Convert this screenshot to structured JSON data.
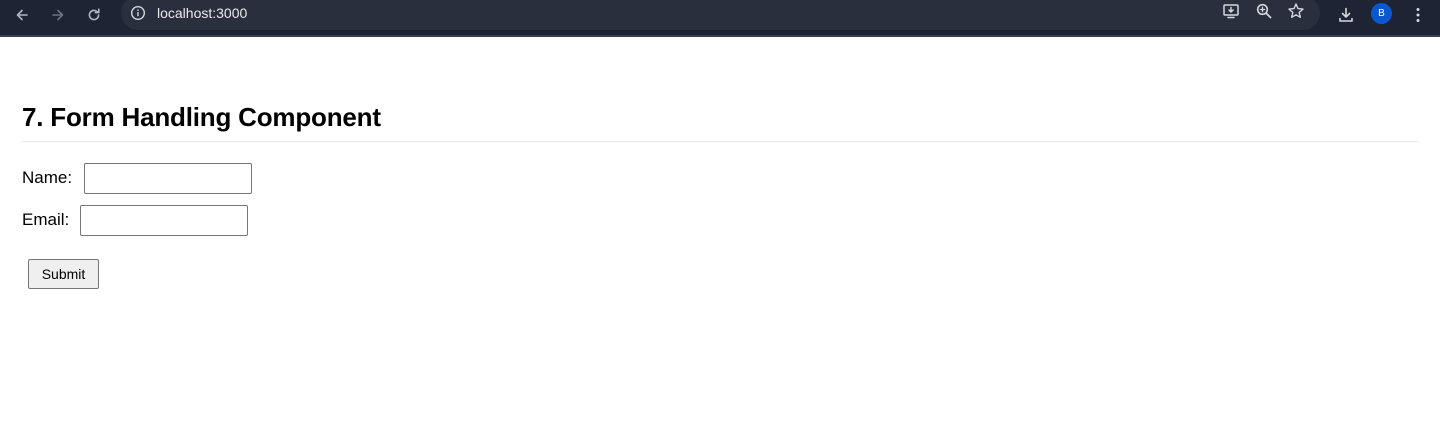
{
  "browser": {
    "url": "localhost:3000",
    "profile_initial": "B",
    "colors": {
      "toolbar_bg": "#1f2434",
      "omnibox_bg": "#2a2f3d",
      "avatar_bg": "#0b57d0"
    },
    "icons": {
      "back": "arrow-left-icon",
      "forward": "arrow-right-icon",
      "reload": "reload-icon",
      "site_info": "info-circle-icon",
      "install": "install-app-icon",
      "zoom": "zoom-icon",
      "bookmark": "star-icon",
      "downloads": "download-icon",
      "menu": "more-vertical-icon"
    }
  },
  "page": {
    "title": "7. Form Handling Component",
    "form": {
      "name_label": "Name:",
      "name_value": "",
      "email_label": "Email:",
      "email_value": "",
      "submit_label": "Submit"
    }
  }
}
